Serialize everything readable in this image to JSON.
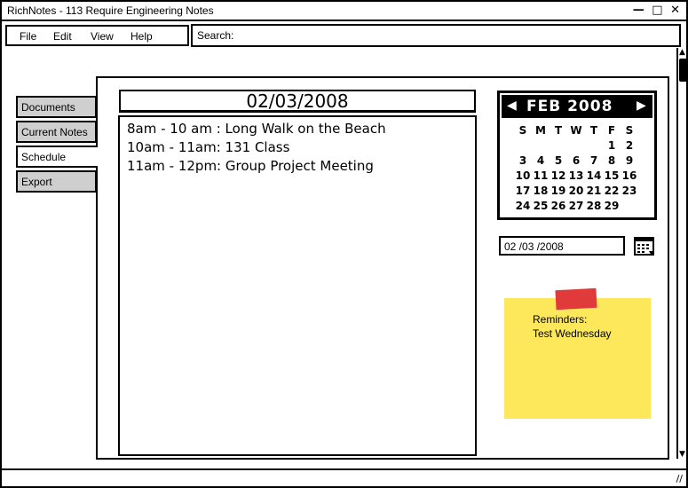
{
  "window": {
    "title": "RichNotes - 113 Require Engineering Notes",
    "minimize": "—",
    "maximize": "□",
    "close": "✕"
  },
  "menu": [
    "File",
    "Edit",
    "View",
    "Help"
  ],
  "search": {
    "label": "Search:",
    "value": ""
  },
  "tabs": [
    "Documents",
    "Current Notes",
    "Schedule",
    "Export"
  ],
  "schedule": {
    "date": "02/03/2008",
    "entries": [
      "8am - 10 am : Long Walk on the Beach",
      "10am - 11am: 131 Class",
      "11am - 12pm: Group Project Meeting"
    ]
  },
  "calendar": {
    "month_label": "FEB 2008",
    "prev": "◀",
    "next": "▶",
    "weekdays": [
      "S",
      "M",
      "T",
      "W",
      "T",
      "F",
      "S"
    ],
    "weeks": [
      [
        "",
        "",
        "",
        "",
        "",
        "1",
        "2"
      ],
      [
        "3",
        "4",
        "5",
        "6",
        "7",
        "8",
        "9"
      ],
      [
        "10",
        "11",
        "12",
        "13",
        "14",
        "15",
        "16"
      ],
      [
        "17",
        "18",
        "19",
        "20",
        "21",
        "22",
        "23"
      ],
      [
        "24",
        "25",
        "26",
        "27",
        "28",
        "29",
        ""
      ]
    ]
  },
  "date_picker": {
    "value": "02 /03 /2008",
    "icon": "calendar-icon"
  },
  "reminder": {
    "title": "Reminders:",
    "text": "Test Wednesday"
  },
  "colors": {
    "sticky": "#fde85c",
    "tape": "#e03a3a",
    "tab_inactive": "#cfcfcf"
  }
}
